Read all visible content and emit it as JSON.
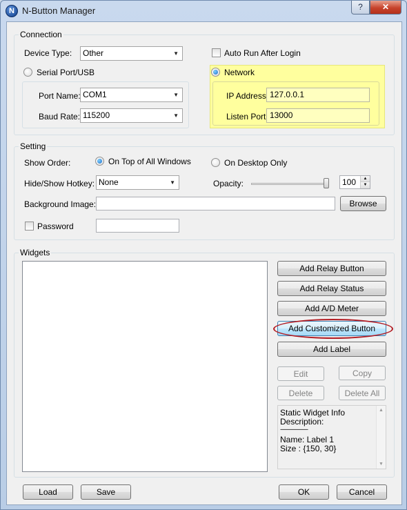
{
  "window": {
    "title": "N-Button Manager",
    "app_icon_letter": "N",
    "help_glyph": "?",
    "close_glyph": "✕"
  },
  "connection": {
    "legend": "Connection",
    "device_type_label": "Device Type:",
    "device_type_value": "Other",
    "auto_run_label": "Auto Run After Login",
    "serial_label": "Serial Port/USB",
    "network_label": "Network",
    "port_name_label": "Port Name:",
    "port_name_value": "COM1",
    "baud_rate_label": "Baud Rate:",
    "baud_rate_value": "115200",
    "ip_label": "IP Address:",
    "ip_value": "127.0.0.1",
    "listen_port_label": "Listen Port:",
    "listen_port_value": "13000",
    "network_highlight_color": "#ffff9e"
  },
  "setting": {
    "legend": "Setting",
    "show_order_label": "Show Order:",
    "on_top_label": "On Top of All Windows",
    "desktop_only_label": "On Desktop Only",
    "hotkey_label": "Hide/Show Hotkey:",
    "hotkey_value": "None",
    "opacity_label": "Opacity:",
    "opacity_value": "100",
    "background_label": "Background Image:",
    "background_value": "",
    "browse_label": "Browse",
    "password_label": "Password",
    "password_value": ""
  },
  "widgets": {
    "legend": "Widgets",
    "add_relay_button": "Add Relay Button",
    "add_relay_status": "Add Relay Status",
    "add_ad_meter": "Add A/D Meter",
    "add_customized_button": "Add Customized Button",
    "add_label": "Add Label",
    "edit": "Edit",
    "copy": "Copy",
    "delete": "Delete",
    "delete_all": "Delete All",
    "info_lines": [
      "Static Widget Info",
      "Description:",
      "--------------------",
      "",
      "Name: Label 1",
      "Size : {150, 30}"
    ],
    "annotation_color": "#b21c23"
  },
  "footer": {
    "load": "Load",
    "save": "Save",
    "ok": "OK",
    "cancel": "Cancel"
  }
}
